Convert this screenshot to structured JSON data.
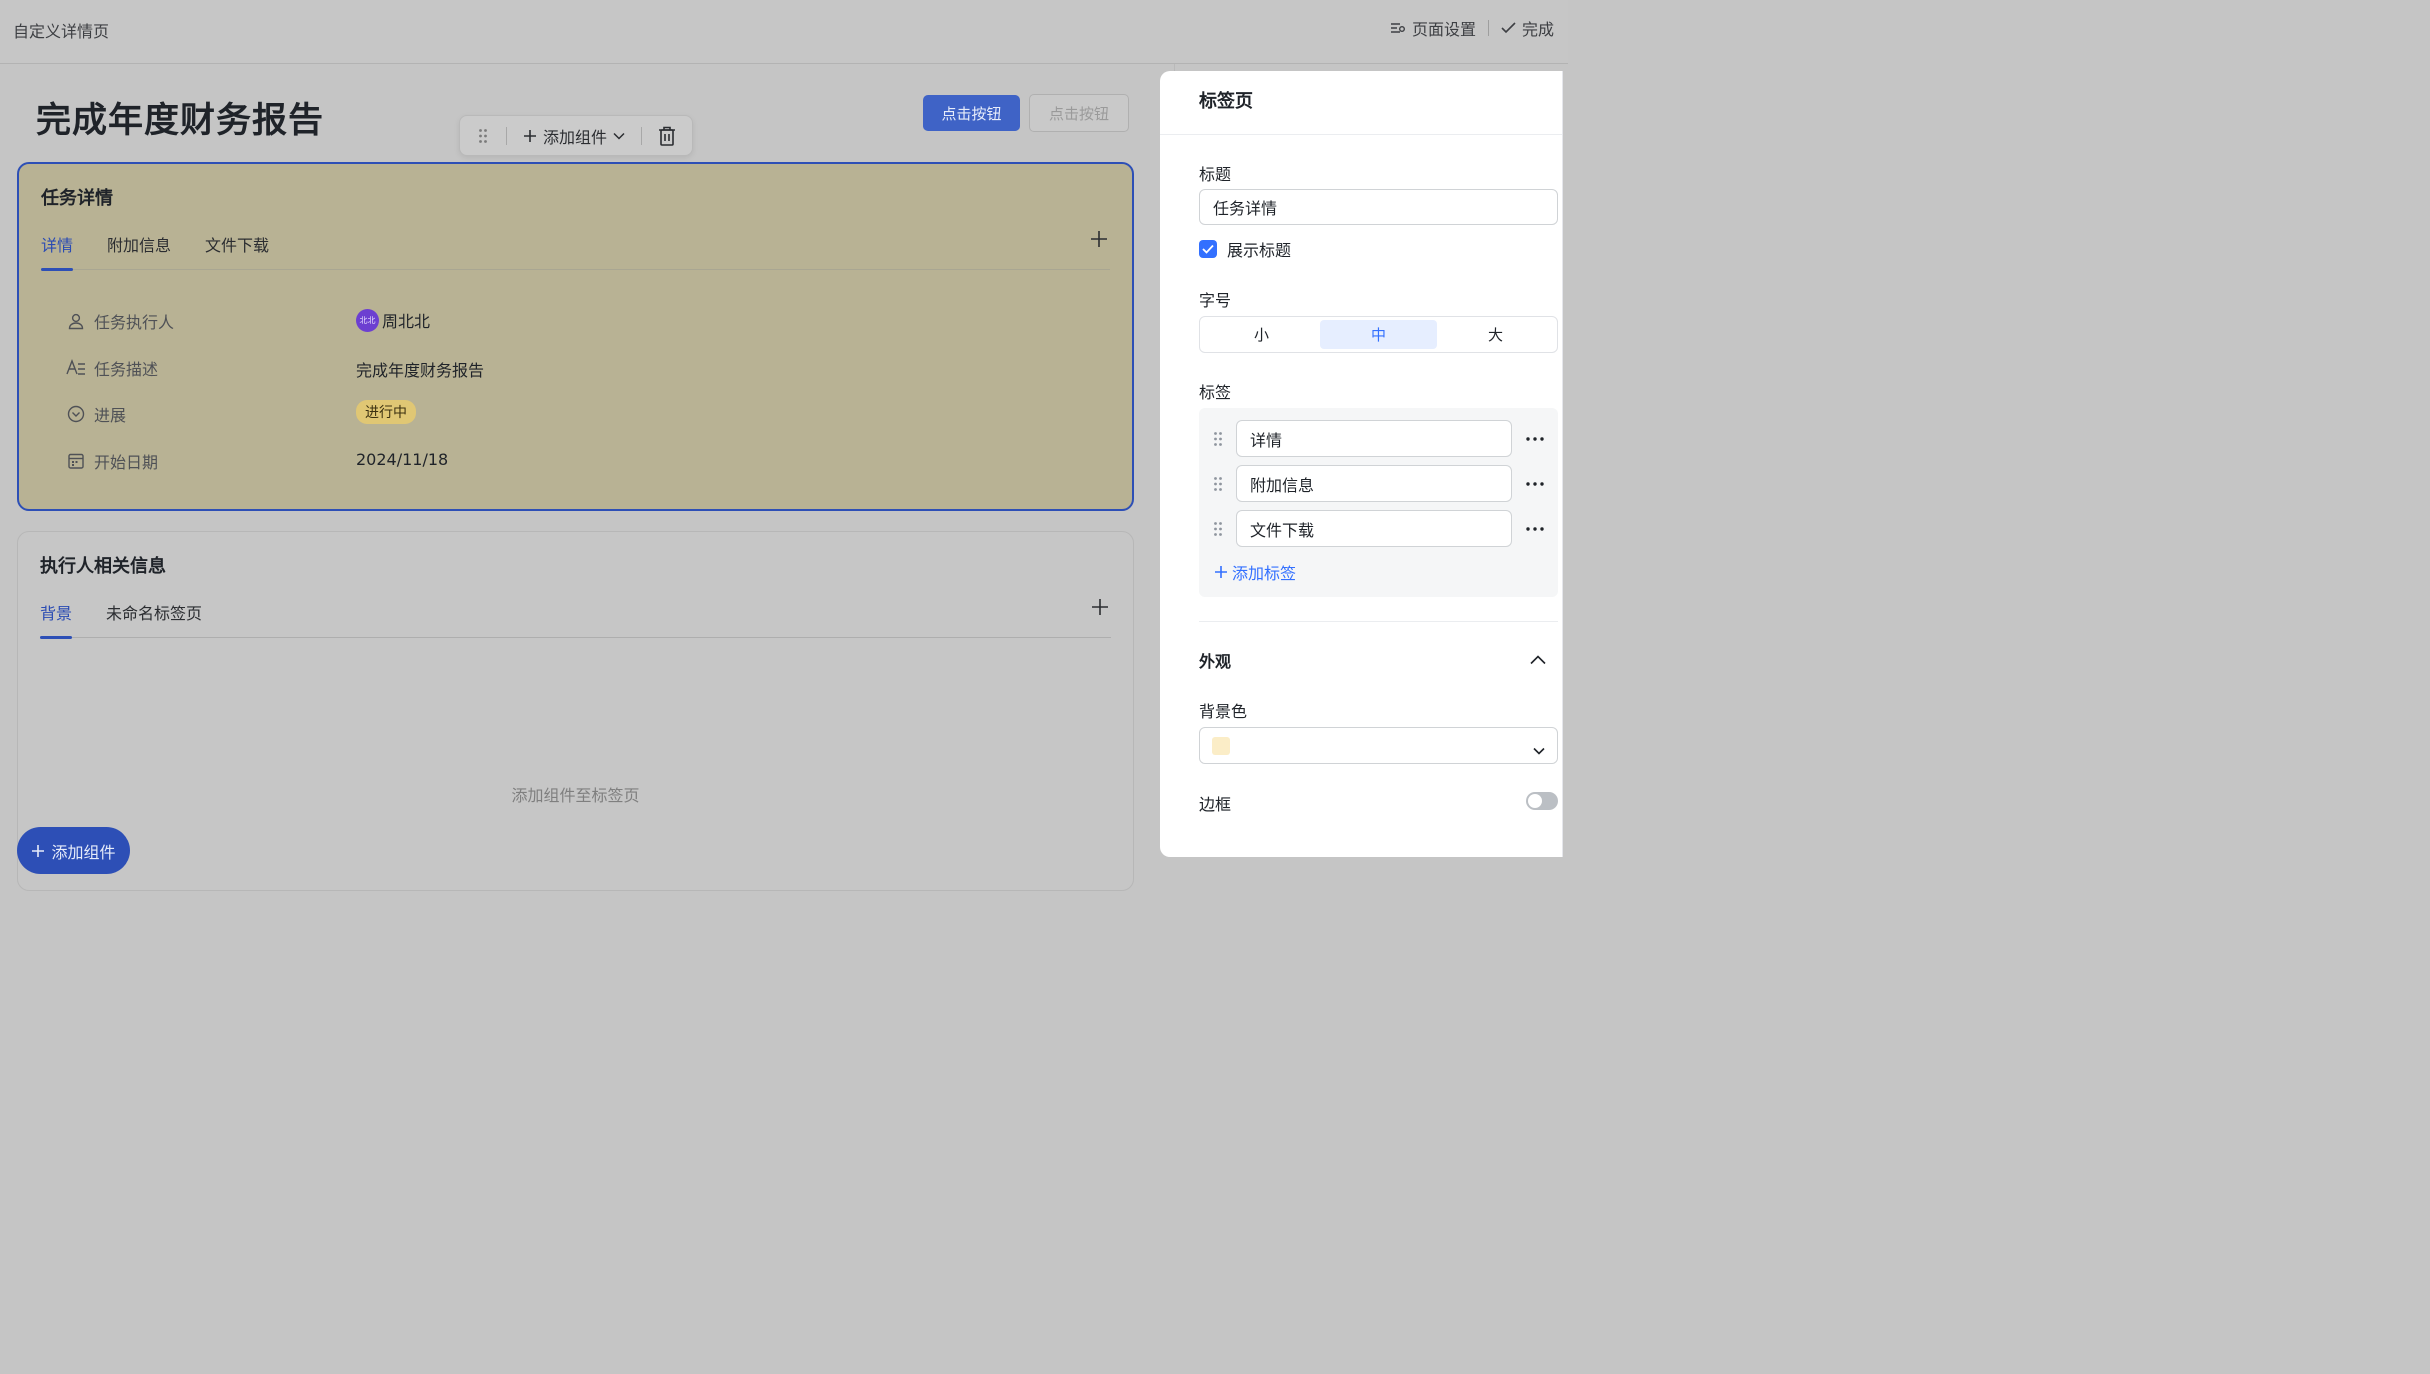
{
  "topbar": {
    "page_name": "自定义详情页",
    "page_settings": "页面设置",
    "done": "完成"
  },
  "page": {
    "title": "完成年度财务报告",
    "primary_button": "点击按钮",
    "secondary_button": "点击按钮"
  },
  "float_toolbar": {
    "add_component": "添加组件"
  },
  "task_card": {
    "title": "任务详情",
    "tabs": [
      {
        "label": "详情"
      },
      {
        "label": "附加信息"
      },
      {
        "label": "文件下载"
      }
    ],
    "fields": [
      {
        "label": "任务执行人",
        "value": "周北北",
        "avatar_text": "北北",
        "icon": "user-icon"
      },
      {
        "label": "任务描述",
        "value": "完成年度财务报告",
        "icon": "text-format-icon"
      },
      {
        "label": "进展",
        "value": "进行中",
        "icon": "progress-circle-icon"
      },
      {
        "label": "开始日期",
        "value": "2024/11/18",
        "icon": "calendar-icon"
      }
    ]
  },
  "exec_card": {
    "title": "执行人相关信息",
    "tabs": [
      {
        "label": "背景"
      },
      {
        "label": "未命名标签页"
      }
    ],
    "empty_hint": "添加组件至标签页"
  },
  "fab": {
    "label": "添加组件"
  },
  "panel": {
    "title": "标签页",
    "title_label": "标题",
    "title_value": "任务详情",
    "show_title_label": "展示标题",
    "font_size_label": "字号",
    "font_sizes": [
      "小",
      "中",
      "大"
    ],
    "tags_label": "标签",
    "tags": [
      {
        "label": "详情"
      },
      {
        "label": "附加信息"
      },
      {
        "label": "文件下载"
      }
    ],
    "add_tag": "添加标签",
    "appearance_label": "外观",
    "bg_color_label": "背景色",
    "bg_color": "#fbedc7",
    "border_label": "边框"
  },
  "colors": {
    "accent": "#2d4fb6",
    "selected_card_bg": "#b8b294",
    "status_badge": "#e0c774"
  }
}
